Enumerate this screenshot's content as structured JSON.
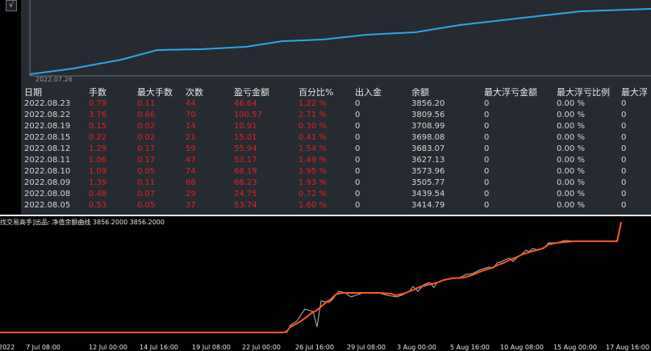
{
  "top": {
    "toggle_glyph": "√",
    "axis_date": "2022.07.26"
  },
  "table": {
    "headers": [
      "日期",
      "手数",
      "最大手数",
      "次数",
      "盈亏金额",
      "百分比%",
      "出入金",
      "余额",
      "最大浮亏金额",
      "最大浮亏比例",
      "最大浮"
    ],
    "rows": [
      [
        "2022.08.23",
        "0.79",
        "0.11",
        "44",
        "46.64",
        "1.22 %",
        "0",
        "3856.20",
        "0",
        "0.00 %",
        "0"
      ],
      [
        "2022.08.22",
        "3.76",
        "0.66",
        "70",
        "100.57",
        "2.71 %",
        "0",
        "3809.56",
        "0",
        "0.00 %",
        "0"
      ],
      [
        "2022.08.19",
        "0.15",
        "0.02",
        "14",
        "10.91",
        "0.30 %",
        "0",
        "3708.99",
        "0",
        "0.00 %",
        "0"
      ],
      [
        "2022.08.15",
        "0.22",
        "0.02",
        "21",
        "15.01",
        "0.41 %",
        "0",
        "3698.08",
        "0",
        "0.00 %",
        "0"
      ],
      [
        "2022.08.12",
        "1.29",
        "0.17",
        "59",
        "55.94",
        "1.54 %",
        "0",
        "3683.07",
        "0",
        "0.00 %",
        "0"
      ],
      [
        "2022.08.11",
        "1.06",
        "0.17",
        "47",
        "53.17",
        "1.49 %",
        "0",
        "3627.13",
        "0",
        "0.00 %",
        "0"
      ],
      [
        "2022.08.10",
        "1.09",
        "0.05",
        "74",
        "68.19",
        "1.95 %",
        "0",
        "3573.96",
        "0",
        "0.00 %",
        "0"
      ],
      [
        "2022.08.09",
        "1.39",
        "0.11",
        "68",
        "68.23",
        "1.93 %",
        "0",
        "3505.77",
        "0",
        "0.00 %",
        "0"
      ],
      [
        "2022.08.08",
        "0.48",
        "0.07",
        "29",
        "24.75",
        "0.72 %",
        "0",
        "3439.54",
        "0",
        "0.00 %",
        "0"
      ],
      [
        "2022.08.05",
        "0.53",
        "0.05",
        "37",
        "53.74",
        "1.60 %",
        "0",
        "3414.79",
        "0",
        "0.00 %",
        "0"
      ]
    ]
  },
  "bottom": {
    "legend": "找交易高手]出品: 净值余额曲线 3856.2000 3856.2000",
    "xticks": [
      "2022",
      "7 Jul 08:00",
      "12 Jul 00:00",
      "14 Jul 16:00",
      "19 Jul 08:00",
      "22 Jul 00:00",
      "26 Jul 16:00",
      "29 Jul 08:00",
      "3 Aug 00:00",
      "5 Aug 16:00",
      "10 Aug 08:00",
      "15 Aug 00:00",
      "17 Aug 16:00"
    ]
  },
  "colors": {
    "equity_line": "#2aa7e6",
    "balance_line": "#ff5a1a",
    "loss_red": "#e0201f",
    "panel_bg": "#262a31"
  }
}
